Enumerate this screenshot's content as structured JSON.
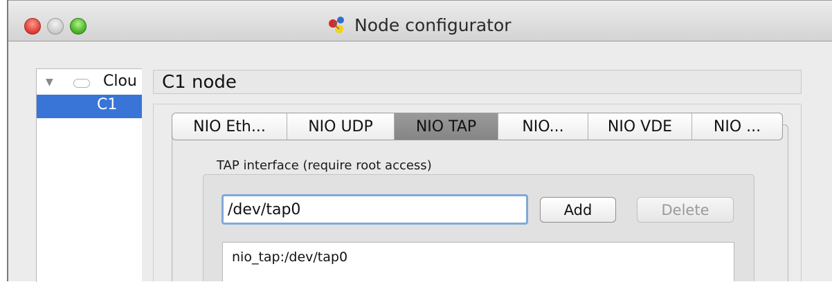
{
  "window": {
    "title": "Node configurator",
    "icon": "gns3-nodes-icon"
  },
  "tree": {
    "items": [
      {
        "label": "Clou",
        "icon": "cloud-icon",
        "expanded": true,
        "selected": false
      },
      {
        "label": "C1",
        "selected": true
      }
    ]
  },
  "panel": {
    "header": "C1 node",
    "tabs": [
      {
        "label": "NIO Eth...",
        "selected": false
      },
      {
        "label": "NIO UDP",
        "selected": false
      },
      {
        "label": "NIO TAP",
        "selected": true
      },
      {
        "label": "NIO...",
        "selected": false
      },
      {
        "label": "NIO VDE",
        "selected": false
      },
      {
        "label": "NIO ...",
        "selected": false
      }
    ],
    "tap": {
      "group_title": "TAP interface (require root access)",
      "input_value": "/dev/tap0",
      "add_label": "Add",
      "delete_label": "Delete",
      "delete_enabled": false,
      "list": [
        "nio_tap:/dev/tap0"
      ]
    }
  },
  "colors": {
    "selection": "#3875d7",
    "focus_ring": "#7fa8d9",
    "close_button": "#e0443a",
    "zoom_button": "#4fb82d"
  }
}
